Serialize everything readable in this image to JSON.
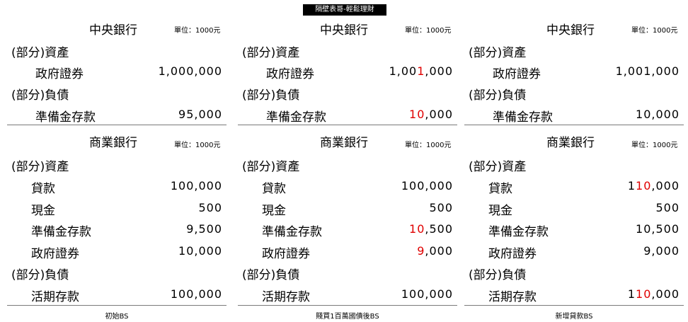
{
  "banner": "隔壁表哥-輕鬆理財",
  "panels": [
    {
      "central_title": "中央銀行",
      "unit": "單位：1000元",
      "assets_label": "(部分)資產",
      "gov_bonds_label": "政府證券",
      "gov_bonds_value": [
        "1,000,000"
      ],
      "liab_label": "(部分)負債",
      "reserve_dep_label": "準備金存款",
      "reserve_dep_value": [
        "95,000"
      ],
      "commercial_title": "商業銀行",
      "c_unit": "單位：1000元",
      "c_assets_label": "(部分)資產",
      "loans_label": "貸款",
      "loans_value": [
        "100,000"
      ],
      "cash_label": "現金",
      "cash_value": [
        "500"
      ],
      "c_reserve_label": "準備金存款",
      "c_reserve_value": [
        "9,500"
      ],
      "c_bonds_label": "政府證券",
      "c_bonds_value": [
        "10,000"
      ],
      "c_liab_label": "(部分)負債",
      "demand_label": "活期存款",
      "demand_value": [
        "100,000"
      ],
      "caption": "初始BS"
    },
    {
      "central_title": "中央銀行",
      "unit": "單位：1000元",
      "assets_label": "(部分)資產",
      "gov_bonds_label": "政府證券",
      "gov_bonds_value": [
        "1,00",
        "1",
        ",000"
      ],
      "liab_label": "(部分)負債",
      "reserve_dep_label": "準備金存款",
      "reserve_dep_value": [
        "",
        "10",
        ",000"
      ],
      "commercial_title": "商業銀行",
      "c_unit": "單位：1000元",
      "c_assets_label": "(部分)資產",
      "loans_label": "貸款",
      "loans_value": [
        "100,000"
      ],
      "cash_label": "現金",
      "cash_value": [
        "500"
      ],
      "c_reserve_label": "準備金存款",
      "c_reserve_value": [
        "",
        "10",
        ",500"
      ],
      "c_bonds_label": "政府證券",
      "c_bonds_value": [
        "",
        "9",
        ",000"
      ],
      "c_liab_label": "(部分)負債",
      "demand_label": "活期存款",
      "demand_value": [
        "100,000"
      ],
      "caption": "賤買1百萬國債後BS"
    },
    {
      "central_title": "中央銀行",
      "unit": "單位：1000元",
      "assets_label": "(部分)資產",
      "gov_bonds_label": "政府證券",
      "gov_bonds_value": [
        "1,001,000"
      ],
      "liab_label": "(部分)負債",
      "reserve_dep_label": "準備金存款",
      "reserve_dep_value": [
        "10,000"
      ],
      "commercial_title": "商業銀行",
      "c_unit": "單位：1000元",
      "c_assets_label": "(部分)資產",
      "loans_label": "貸款",
      "loans_value": [
        "1",
        "10",
        ",000"
      ],
      "cash_label": "現金",
      "cash_value": [
        "500"
      ],
      "c_reserve_label": "準備金存款",
      "c_reserve_value": [
        "10,500"
      ],
      "c_bonds_label": "政府證券",
      "c_bonds_value": [
        "9,000"
      ],
      "c_liab_label": "(部分)負債",
      "demand_label": "活期存款",
      "demand_value": [
        "1",
        "10",
        ",000"
      ],
      "caption": "新增貸款BS"
    }
  ],
  "colors": {
    "highlight": "#e00000",
    "rule": "#7a7a7a",
    "banner_bg": "#000000"
  }
}
